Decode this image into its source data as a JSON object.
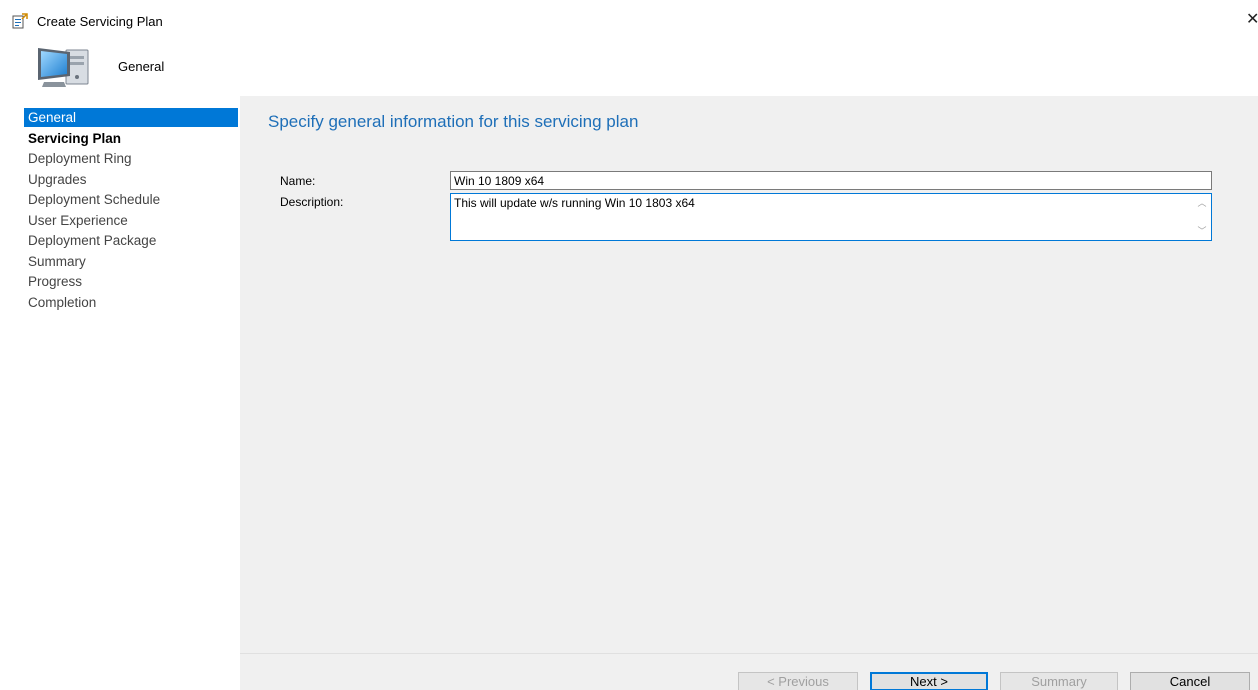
{
  "window": {
    "title": "Create Servicing Plan",
    "close_glyph": "✕"
  },
  "header": {
    "title": "General",
    "icon": "computer-icon"
  },
  "sidebar": {
    "items": [
      {
        "label": "General"
      },
      {
        "label": "Servicing Plan"
      },
      {
        "label": "Deployment Ring"
      },
      {
        "label": "Upgrades"
      },
      {
        "label": "Deployment Schedule"
      },
      {
        "label": "User Experience"
      },
      {
        "label": "Deployment Package"
      },
      {
        "label": "Summary"
      },
      {
        "label": "Progress"
      },
      {
        "label": "Completion"
      }
    ]
  },
  "main": {
    "heading": "Specify general information for this servicing plan",
    "name_label": "Name:",
    "name_value": "Win 10 1809 x64",
    "description_label": "Description:",
    "description_value": "This will update w/s running Win 10 1803 x64"
  },
  "footer": {
    "previous_label": "< Previous",
    "next_label": "Next >",
    "summary_label": "Summary",
    "cancel_label": "Cancel"
  },
  "colors": {
    "accent": "#0078d7",
    "heading": "#1e6fb8",
    "panel_bg": "#f0f0f0"
  }
}
